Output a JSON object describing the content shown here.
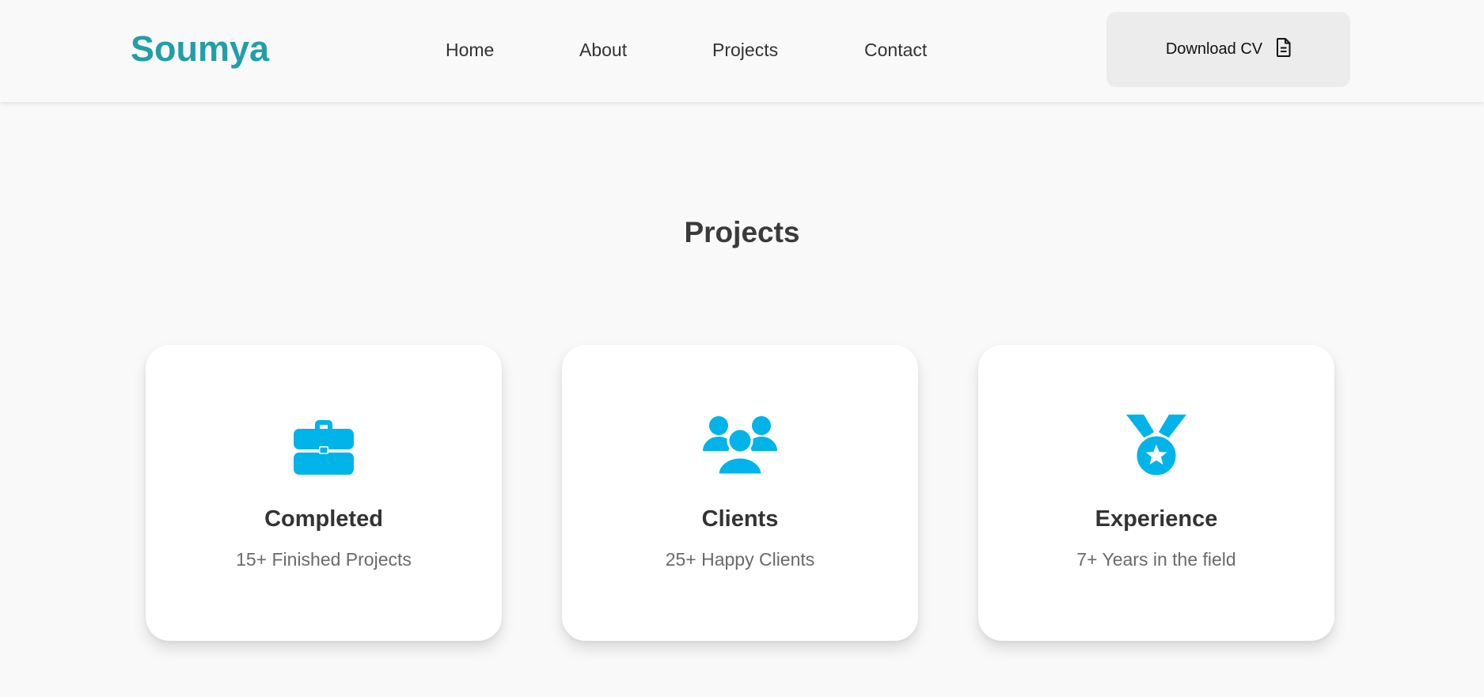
{
  "brand": {
    "name": "Soumya",
    "color": "#229ea9"
  },
  "nav": {
    "items": [
      {
        "label": "Home"
      },
      {
        "label": "About"
      },
      {
        "label": "Projects"
      },
      {
        "label": "Contact"
      }
    ],
    "download_label": "Download CV",
    "download_icon": "file-document-icon"
  },
  "section": {
    "title": "Projects"
  },
  "accent_color": "#00b3e8",
  "cards": [
    {
      "icon": "briefcase-icon",
      "title": "Completed",
      "text": "15+ Finished Projects"
    },
    {
      "icon": "users-group-icon",
      "title": "Clients",
      "text": "25+ Happy Clients"
    },
    {
      "icon": "medal-icon",
      "title": "Experience",
      "text": "7+ Years in the field"
    }
  ]
}
